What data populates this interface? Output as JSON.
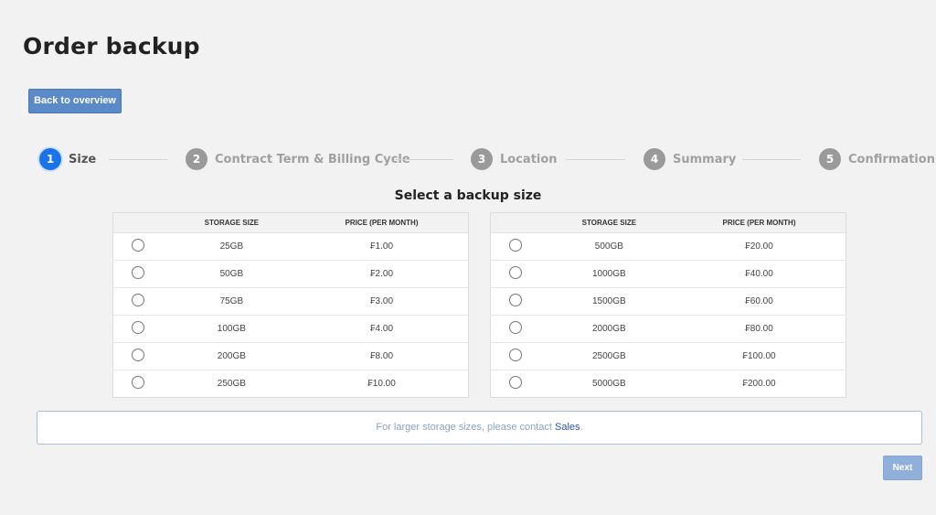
{
  "page": {
    "title": "Order backup",
    "back_label": "Back to overview",
    "next_label": "Next"
  },
  "stepper": {
    "steps": [
      {
        "number": "1",
        "label": "Size",
        "active": true
      },
      {
        "number": "2",
        "label": "Contract Term & Billing Cycle",
        "active": false
      },
      {
        "number": "3",
        "label": "Location",
        "active": false
      },
      {
        "number": "4",
        "label": "Summary",
        "active": false
      },
      {
        "number": "5",
        "label": "Confirmation",
        "active": false
      }
    ]
  },
  "selection": {
    "title": "Select a backup size",
    "columns": {
      "size": "STORAGE SIZE",
      "price": "PRICE (PER MONTH)"
    },
    "left_rows": [
      {
        "size": "25GB",
        "price": "₣1.00"
      },
      {
        "size": "50GB",
        "price": "₣2.00"
      },
      {
        "size": "75GB",
        "price": "₣3.00"
      },
      {
        "size": "100GB",
        "price": "₣4.00"
      },
      {
        "size": "200GB",
        "price": "₣8.00"
      },
      {
        "size": "250GB",
        "price": "₣10.00"
      }
    ],
    "right_rows": [
      {
        "size": "500GB",
        "price": "₣20.00"
      },
      {
        "size": "1000GB",
        "price": "₣40.00"
      },
      {
        "size": "1500GB",
        "price": "₣60.00"
      },
      {
        "size": "2000GB",
        "price": "₣80.00"
      },
      {
        "size": "2500GB",
        "price": "₣100.00"
      },
      {
        "size": "5000GB",
        "price": "₣200.00"
      }
    ]
  },
  "info": {
    "text": "For larger storage sizes, please contact ",
    "link_label": "Sales",
    "suffix": "."
  },
  "colors": {
    "active_step": "#1a73e8",
    "inactive_step": "#9a9a9a",
    "primary_button": "#5b8ac9",
    "disabled_button": "#8fb0db",
    "link": "#2a55a8"
  }
}
